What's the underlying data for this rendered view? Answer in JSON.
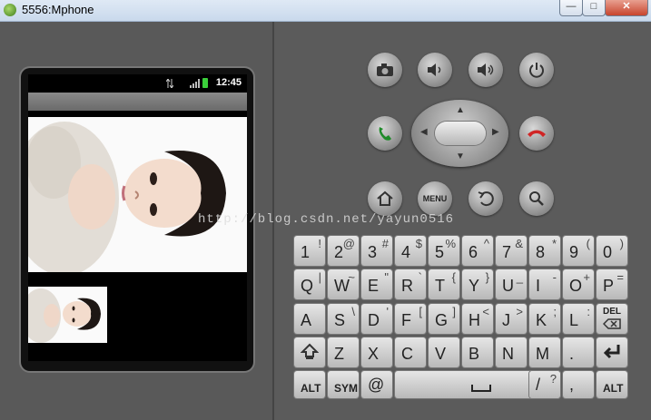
{
  "window": {
    "title": "5556:Mphone",
    "min": "—",
    "max": "□",
    "close": "✕"
  },
  "status": {
    "time": "12:45"
  },
  "watermark": "http://blog.csdn.net/yayun0516",
  "keyboard": {
    "row1": [
      {
        "main": "1",
        "sub": "!"
      },
      {
        "main": "2",
        "sub": "@"
      },
      {
        "main": "3",
        "sub": "#"
      },
      {
        "main": "4",
        "sub": "$"
      },
      {
        "main": "5",
        "sub": "%"
      },
      {
        "main": "6",
        "sub": "^"
      },
      {
        "main": "7",
        "sub": "&"
      },
      {
        "main": "8",
        "sub": "*"
      },
      {
        "main": "9",
        "sub": "("
      },
      {
        "main": "0",
        "sub": ")"
      }
    ],
    "row2": [
      {
        "main": "Q",
        "sub": "|"
      },
      {
        "main": "W",
        "sub": "~"
      },
      {
        "main": "E",
        "sub": "\""
      },
      {
        "main": "R",
        "sub": "`"
      },
      {
        "main": "T",
        "sub": "{"
      },
      {
        "main": "Y",
        "sub": "}"
      },
      {
        "main": "U",
        "sub": "_"
      },
      {
        "main": "I",
        "sub": "-"
      },
      {
        "main": "O",
        "sub": "+"
      },
      {
        "main": "P",
        "sub": "="
      }
    ],
    "row3": [
      {
        "main": "A",
        "sub": ""
      },
      {
        "main": "S",
        "sub": "\\"
      },
      {
        "main": "D",
        "sub": "'"
      },
      {
        "main": "F",
        "sub": "["
      },
      {
        "main": "G",
        "sub": "]"
      },
      {
        "main": "H",
        "sub": "<"
      },
      {
        "main": "J",
        "sub": ">"
      },
      {
        "main": "K",
        "sub": ";"
      },
      {
        "main": "L",
        "sub": ":"
      }
    ],
    "row4": [
      {
        "main": "Z",
        "sub": ""
      },
      {
        "main": "X",
        "sub": ""
      },
      {
        "main": "C",
        "sub": ""
      },
      {
        "main": "V",
        "sub": ""
      },
      {
        "main": "B",
        "sub": ""
      },
      {
        "main": "N",
        "sub": ""
      },
      {
        "main": "M",
        "sub": ""
      },
      {
        "main": ".",
        "sub": ""
      }
    ],
    "del_label": "DEL",
    "alt_label": "ALT",
    "sym_label": "SYM",
    "at_label": "@",
    "slash_label": "/",
    "question_label": "?",
    "comma_label": ","
  },
  "buttons": {
    "menu_label": "MENU"
  }
}
